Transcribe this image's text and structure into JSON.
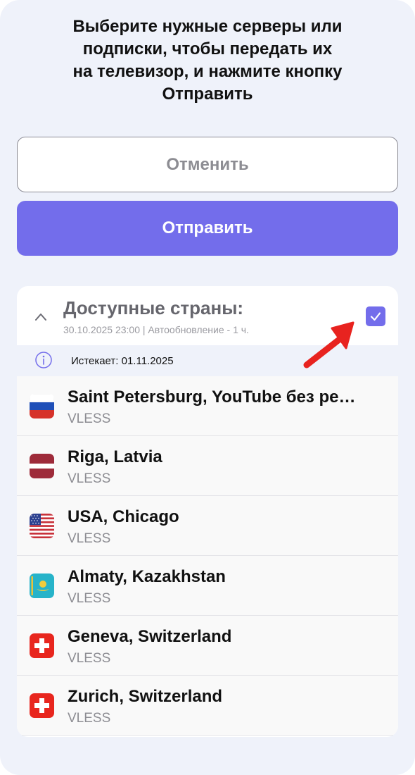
{
  "instruction": "Выберите нужные серверы или\nподписки, чтобы передать их\nна телевизор, и нажмите кнопку\nОтправить",
  "buttons": {
    "cancel_label": "Отменить",
    "send_label": "Отправить"
  },
  "card": {
    "title": "Доступные страны:",
    "subtitle": "30.10.2025 23:00 | Автообновление - 1 ч.",
    "checked": true,
    "expires": "Истекает: 01.11.2025"
  },
  "servers": [
    {
      "name": "Saint Petersburg, YouTube без рек…",
      "protocol": "VLESS",
      "flag": "russia-flag"
    },
    {
      "name": "Riga, Latvia",
      "protocol": "VLESS",
      "flag": "latvia-flag"
    },
    {
      "name": "USA, Chicago",
      "protocol": "VLESS",
      "flag": "usa-flag"
    },
    {
      "name": "Almaty, Kazakhstan",
      "protocol": "VLESS",
      "flag": "kazakhstan-flag"
    },
    {
      "name": "Geneva, Switzerland",
      "protocol": "VLESS",
      "flag": "switzerland-flag"
    },
    {
      "name": "Zurich, Switzerland",
      "protocol": "VLESS",
      "flag": "switzerland-flag"
    }
  ],
  "colors": {
    "accent": "#736deb",
    "background": "#eff2fa",
    "annotation_arrow": "#e8231f"
  }
}
